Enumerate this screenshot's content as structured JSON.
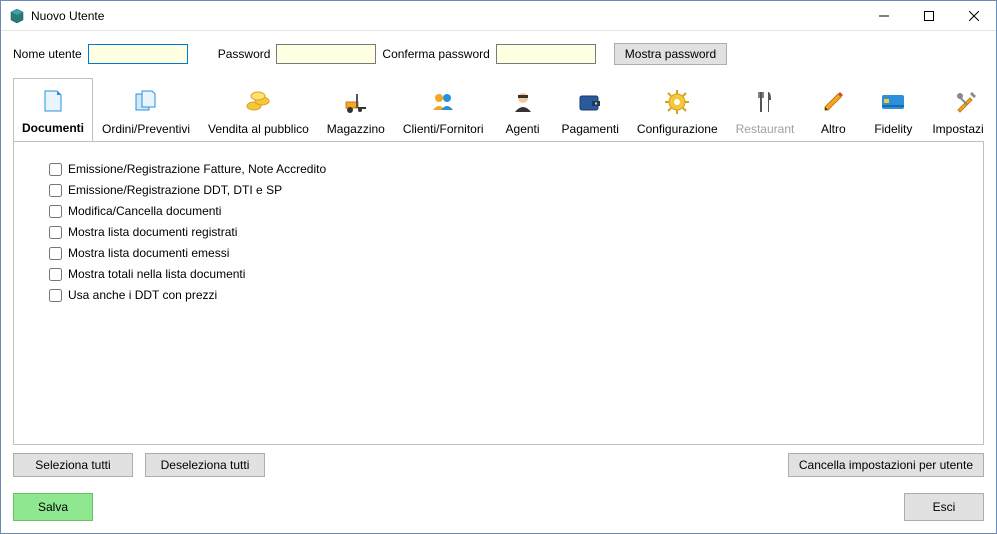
{
  "window": {
    "title": "Nuovo Utente"
  },
  "form": {
    "username_label": "Nome utente",
    "username_value": "",
    "password_label": "Password",
    "password_value": "",
    "confirm_label": "Conferma password",
    "confirm_value": "",
    "show_password_label": "Mostra password"
  },
  "tabs": [
    {
      "label": "Documenti",
      "active": true
    },
    {
      "label": "Ordini/Preventivi"
    },
    {
      "label": "Vendita al pubblico"
    },
    {
      "label": "Magazzino"
    },
    {
      "label": "Clienti/Fornitori"
    },
    {
      "label": "Agenti"
    },
    {
      "label": "Pagamenti"
    },
    {
      "label": "Configurazione"
    },
    {
      "label": "Restaurant",
      "disabled": true
    },
    {
      "label": "Altro"
    },
    {
      "label": "Fidelity"
    },
    {
      "label": "Impostazioni"
    }
  ],
  "checks": [
    {
      "label": "Emissione/Registrazione Fatture, Note Accredito",
      "checked": false
    },
    {
      "label": "Emissione/Registrazione DDT, DTI e SP",
      "checked": false
    },
    {
      "label": "Modifica/Cancella documenti",
      "checked": false
    },
    {
      "label": "Mostra lista documenti registrati",
      "checked": false
    },
    {
      "label": "Mostra lista documenti emessi",
      "checked": false
    },
    {
      "label": "Mostra totali nella lista documenti",
      "checked": false
    },
    {
      "label": "Usa anche i DDT con prezzi",
      "checked": false
    }
  ],
  "footer": {
    "select_all": "Seleziona tutti",
    "deselect_all": "Deseleziona tutti",
    "delete_settings": "Cancella impostazioni per utente",
    "save": "Salva",
    "exit": "Esci"
  }
}
